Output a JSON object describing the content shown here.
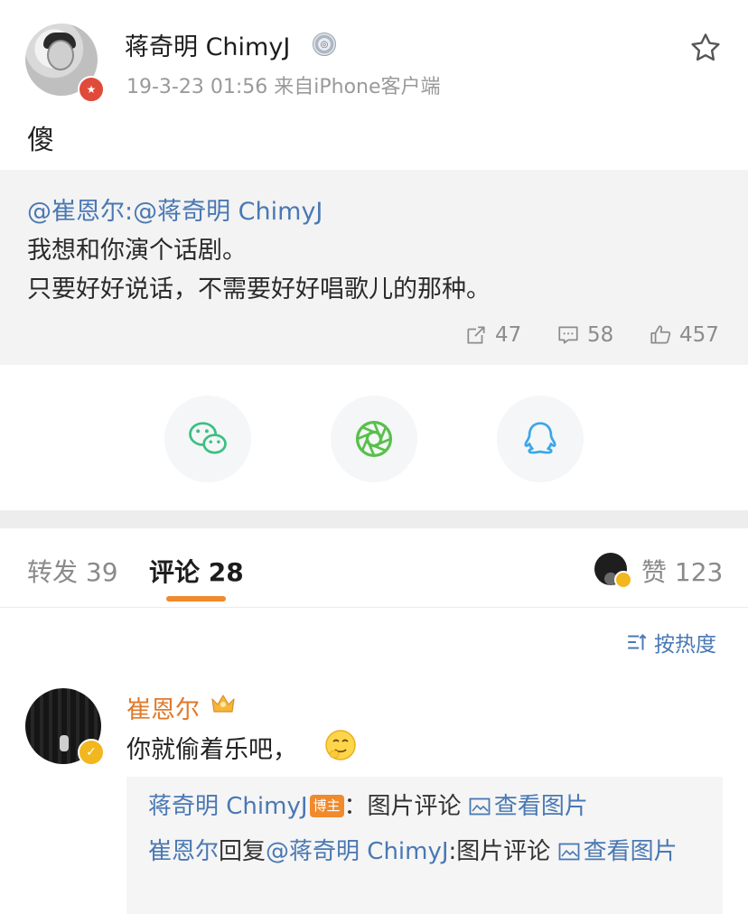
{
  "post": {
    "author_name": "蒋奇明 ChimyJ",
    "meta": "19-3-23 01:56  来自iPhone客户端",
    "text": "傻"
  },
  "quoted": {
    "mention": "@崔恩尔:@蒋奇明 ChimyJ",
    "line1": "我想和你演个话剧。",
    "line2": "只要好好说话，不需要好好唱歌儿的那种。",
    "reposts": "47",
    "comments": "58",
    "likes": "457"
  },
  "share": {
    "icons": [
      "wechat-icon",
      "moments-icon",
      "qq-icon"
    ]
  },
  "tabs": {
    "forward": "转发 39",
    "comment": "评论 28",
    "likes": "赞 123"
  },
  "sort": {
    "label": "按热度"
  },
  "comment": {
    "author": "崔恩尔",
    "text": "你就偷着乐吧，",
    "reply1": {
      "name": "蒋奇明 ChimyJ",
      "badge": "博主",
      "sep": "：",
      "content": "图片评论",
      "view_link": "查看图片"
    },
    "reply2": {
      "name": "崔恩尔",
      "action": "回复",
      "mention": "@蒋奇明 ChimyJ",
      "content": ":图片评论",
      "view_link": "查看图片"
    }
  },
  "colors": {
    "link": "#4a78b3",
    "accent": "#f08a2c",
    "name_orange": "#e0792b",
    "quote_bg": "#f3f3f3"
  }
}
